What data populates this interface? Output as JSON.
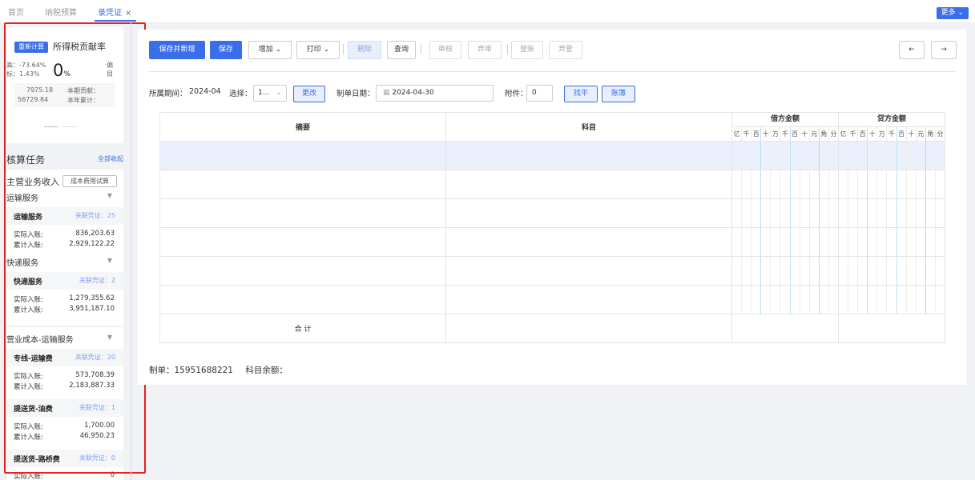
{
  "tabs": [
    {
      "label": "首页",
      "active": false
    },
    {
      "label": "纳税预算",
      "active": false
    },
    {
      "label": "录凭证",
      "active": true,
      "closable": true
    }
  ],
  "tab_close_glyph": "×",
  "more_label": "更多",
  "left": {
    "recalc_label": "重新计算",
    "card_title": "所得税贡献率",
    "stat1": "高：-73.64%",
    "stat2": "标：1.43%",
    "big_value": "0",
    "big_unit": "%",
    "side_label_1": "偏",
    "side_label_2": "目",
    "summary": [
      {
        "value": "7975.18",
        "label": "本期贡献："
      },
      {
        "value": "56729.84",
        "label": "本年累计："
      }
    ],
    "section_title": "核算任务",
    "collapse_all": "全部收起",
    "main_income_title": "主营业务收入",
    "cost_calc_label": "成本费用试算",
    "groups": [
      {
        "name": "运输服务",
        "items": [
          {
            "name": "运输服务",
            "link": "关联凭证：25",
            "actual_label": "实际入账:",
            "actual": "836,203.63",
            "cum_label": "累计入账:",
            "cum": "2,929,122.22"
          }
        ]
      },
      {
        "name": "快递服务",
        "items": [
          {
            "name": "快递服务",
            "link": "关联凭证：2",
            "actual_label": "实际入账:",
            "actual": "1,279,355.62",
            "cum_label": "累计入账:",
            "cum": "3,951,187.10"
          }
        ]
      }
    ],
    "cost_title": "营业成本-运输服务",
    "cost_items": [
      {
        "name": "专线-运输费",
        "link": "关联凭证：20",
        "actual_label": "实际入账:",
        "actual": "573,708.39",
        "cum_label": "累计入账:",
        "cum": "2,183,887.33"
      },
      {
        "name": "提送货-油费",
        "link": "关联凭证：1",
        "actual_label": "实际入账:",
        "actual": "1,700.00",
        "cum_label": "累计入账:",
        "cum": "46,950.23"
      },
      {
        "name": "提送货-路桥费",
        "link": "关联凭证：0",
        "actual_label": "实际入账:",
        "actual": "0"
      }
    ]
  },
  "toolbar": {
    "save_new": "保存并新增",
    "save": "保存",
    "add": "增加",
    "print": "打印",
    "delete": "删除",
    "query": "查询",
    "audit": "审核",
    "unaudit": "弃审",
    "post": "登账",
    "unpost": "弃登",
    "prev": "←",
    "next": "→"
  },
  "form": {
    "period_label": "所属期间：",
    "period_value": "2024-04",
    "choose_label": "选择：",
    "choose_value": "1...",
    "change_btn": "更改",
    "date_label": "制单日期：",
    "date_value": "2024-04-30",
    "attach_label": "附件：",
    "attach_value": "0",
    "balance_btn": "找平",
    "ledger_btn": "账簿"
  },
  "table": {
    "col_summary": "摘要",
    "col_subject": "科目",
    "col_debit": "借方金额",
    "col_credit": "贷方金额",
    "units": [
      "亿",
      "千",
      "百",
      "十",
      "万",
      "千",
      "百",
      "十",
      "元",
      "角",
      "分"
    ],
    "total_label": "合 计"
  },
  "footer": {
    "maker_label": "制单：",
    "maker_value": "15951688221",
    "balance_label": "科目余额："
  },
  "colors": {
    "accent": "#3a6ee8",
    "highlight": "#e82020"
  }
}
